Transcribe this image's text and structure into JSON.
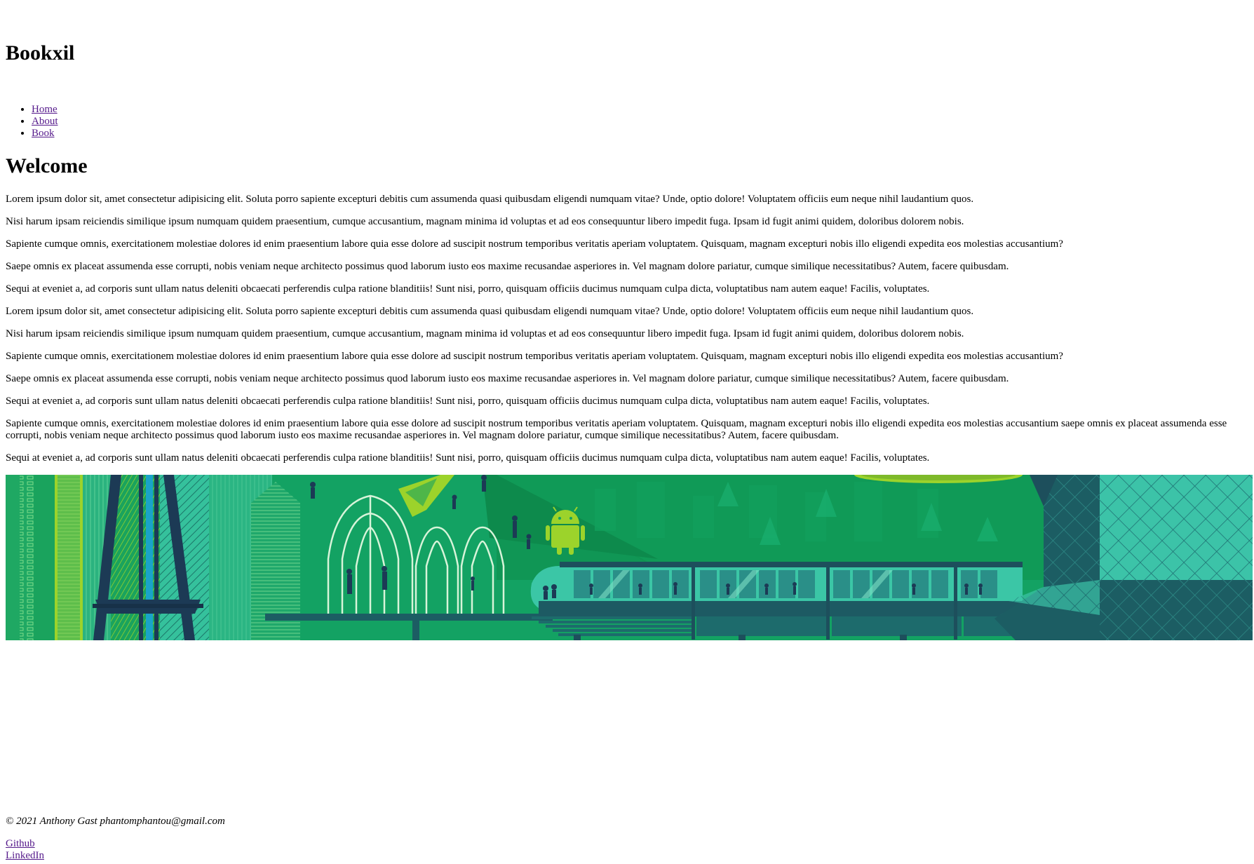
{
  "header": {
    "title": "Bookxil"
  },
  "nav": {
    "items": [
      {
        "label": "Home"
      },
      {
        "label": "About"
      },
      {
        "label": "Book"
      }
    ]
  },
  "main": {
    "heading": "Welcome",
    "paragraphs": [
      "Lorem ipsum dolor sit, amet consectetur adipisicing elit. Soluta porro sapiente excepturi debitis cum assumenda quasi quibusdam eligendi numquam vitae? Unde, optio dolore! Voluptatem officiis eum neque nihil laudantium quos.",
      "Nisi harum ipsam reiciendis similique ipsum numquam quidem praesentium, cumque accusantium, magnam minima id voluptas et ad eos consequuntur libero impedit fuga. Ipsam id fugit animi quidem, doloribus dolorem nobis.",
      "Sapiente cumque omnis, exercitationem molestiae dolores id enim praesentium labore quia esse dolore ad suscipit nostrum temporibus veritatis aperiam voluptatem. Quisquam, magnam excepturi nobis illo eligendi expedita eos molestias accusantium?",
      "Saepe omnis ex placeat assumenda esse corrupti, nobis veniam neque architecto possimus quod laborum iusto eos maxime recusandae asperiores in. Vel magnam dolore pariatur, cumque similique necessitatibus? Autem, facere quibusdam.",
      "Sequi at eveniet a, ad corporis sunt ullam natus deleniti obcaecati perferendis culpa ratione blanditiis! Sunt nisi, porro, quisquam officiis ducimus numquam culpa dicta, voluptatibus nam autem eaque! Facilis, voluptates.",
      "Lorem ipsum dolor sit, amet consectetur adipisicing elit. Soluta porro sapiente excepturi debitis cum assumenda quasi quibusdam eligendi numquam vitae? Unde, optio dolore! Voluptatem officiis eum neque nihil laudantium quos.",
      "Nisi harum ipsam reiciendis similique ipsum numquam quidem praesentium, cumque accusantium, magnam minima id voluptas et ad eos consequuntur libero impedit fuga. Ipsam id fugit animi quidem, doloribus dolorem nobis.",
      "Sapiente cumque omnis, exercitationem molestiae dolores id enim praesentium labore quia esse dolore ad suscipit nostrum temporibus veritatis aperiam voluptatem. Quisquam, magnam excepturi nobis illo eligendi expedita eos molestias accusantium?",
      "Saepe omnis ex placeat assumenda esse corrupti, nobis veniam neque architecto possimus quod laborum iusto eos maxime recusandae asperiores in. Vel magnam dolore pariatur, cumque similique necessitatibus? Autem, facere quibusdam.",
      "Sequi at eveniet a, ad corporis sunt ullam natus deleniti obcaecati perferendis culpa ratione blanditiis! Sunt nisi, porro, quisquam officiis ducimus numquam culpa dicta, voluptatibus nam autem eaque! Facilis, voluptates.",
      "Sapiente cumque omnis, exercitationem molestiae dolores id enim praesentium labore quia esse dolore ad suscipit nostrum temporibus veritatis aperiam voluptatem. Quisquam, magnam excepturi nobis illo eligendi expedita eos molestias accusantium saepe omnis ex placeat assumenda esse corrupti, nobis veniam neque architecto possimus quod laborum iusto eos maxime recusandae asperiores in. Vel magnam dolore pariatur, cumque similique necessitatibus? Autem, facere quibusdam.",
      "Sequi at eveniet a, ad corporis sunt ullam natus deleniti obcaecati perferendis culpa ratione blanditiis! Sunt nisi, porro, quisquam officiis ducimus numquam culpa dicta, voluptatibus nam autem eaque! Facilis, voluptates."
    ]
  },
  "banner": {
    "icon": "android-icon",
    "colors": {
      "background": "#12a060",
      "dark_teal": "#1d4f5c",
      "mid_green": "#17a35e",
      "light_teal": "#3bc6a6",
      "lime": "#9cd32b",
      "navy": "#1c3a55"
    }
  },
  "footer": {
    "copyright": "© 2021 Anthony Gast phantomphantou@gmail.com",
    "links": [
      {
        "label": "Github"
      },
      {
        "label": "LinkedIn"
      }
    ]
  },
  "colors": {
    "link": "#551a8b",
    "text": "#000000",
    "background": "#ffffff"
  }
}
